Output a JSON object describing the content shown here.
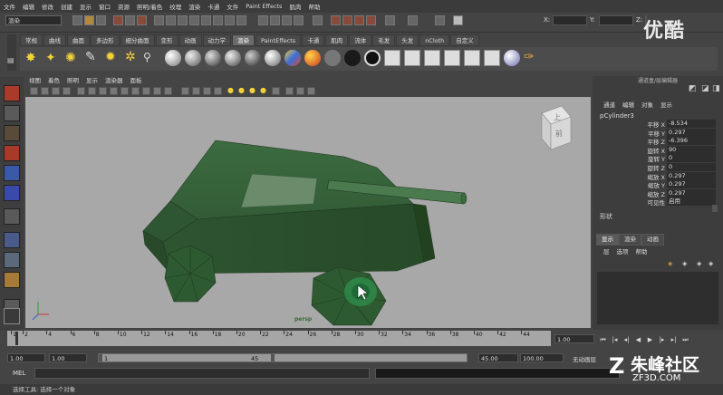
{
  "menu": [
    "文件",
    "编辑",
    "修改",
    "创建",
    "显示",
    "窗口",
    "资源",
    "照明/着色",
    "纹理",
    "渲染",
    "卡通",
    "文件",
    "Paint Effects",
    "肌肉",
    "帮助"
  ],
  "status_line": {
    "mode": "渲染",
    "coord_labels": {
      "x": "X:",
      "y": "Y:",
      "z": "Z:"
    }
  },
  "shelf_tabs": [
    "常规",
    "曲线",
    "曲面",
    "多边形",
    "细分曲面",
    "变形",
    "动画",
    "动力学",
    "渲染",
    "PaintEffects",
    "卡通",
    "肌肉",
    "流体",
    "毛发",
    "头发",
    "nCloth",
    "自定义"
  ],
  "shelf_active": "渲染",
  "panel_menu": [
    "视图",
    "着色",
    "照明",
    "显示",
    "渲染器",
    "面板"
  ],
  "viewport": {
    "camera": "persp",
    "view_cube_top": "上",
    "view_cube_front": "前"
  },
  "right_panel": {
    "title": "通道盒/层编辑器",
    "menu": [
      "通道",
      "编辑",
      "对象",
      "显示"
    ],
    "object_name": "pCylinder3",
    "attributes": [
      {
        "label": "平移 X",
        "value": "-8.534"
      },
      {
        "label": "平移 Y",
        "value": "0.297"
      },
      {
        "label": "平移 Z",
        "value": "-6.396"
      },
      {
        "label": "旋转 X",
        "value": "90"
      },
      {
        "label": "旋转 Y",
        "value": "0"
      },
      {
        "label": "旋转 Z",
        "value": "0"
      },
      {
        "label": "缩放 X",
        "value": "0.297"
      },
      {
        "label": "缩放 Y",
        "value": "0.297"
      },
      {
        "label": "缩放 Z",
        "value": "0.297"
      },
      {
        "label": "可见性",
        "value": "启用"
      }
    ],
    "shapes_label": "形状",
    "layer_tabs": [
      "显示",
      "渲染",
      "动画"
    ],
    "layer_menu": [
      "层",
      "选项",
      "帮助"
    ]
  },
  "timeline": {
    "ticks": [
      "1",
      "2",
      "4",
      "6",
      "8",
      "10",
      "12",
      "14",
      "16",
      "18",
      "20",
      "22",
      "24",
      "26",
      "28",
      "30",
      "32",
      "34",
      "36",
      "38",
      "40",
      "42",
      "44"
    ],
    "current_frame": "1.00"
  },
  "range": {
    "start": "1.00",
    "anim_start": "1.00",
    "range_start": "1",
    "range_end": "45",
    "anim_end": "45.00",
    "end": "100.00",
    "charset": "无动画层"
  },
  "mel": {
    "label": "MEL"
  },
  "help_line": "选择工具: 选择一个对象",
  "watermarks": {
    "youku": "优酷",
    "zf_big": "朱峰社区",
    "zf_small": "ZF3D.COM"
  }
}
